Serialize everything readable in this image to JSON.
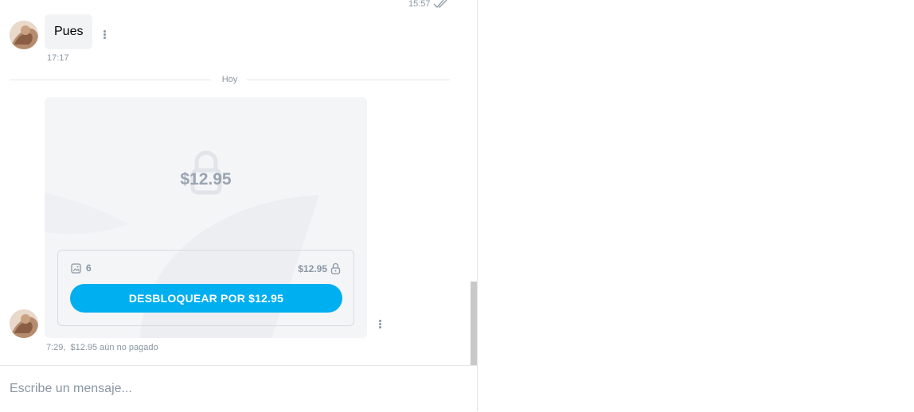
{
  "messages": {
    "top_time": "15:57",
    "pues": {
      "text": "Pues",
      "time": "17:17"
    },
    "divider": "Hoy",
    "locked_post": {
      "price_overlay": "$12.95",
      "media_count": "6",
      "price": "$12.95",
      "unlock_button": "DESBLOQUEAR POR $12.95",
      "time": "7:29,",
      "status": "$12.95 aún no pagado"
    }
  },
  "composer": {
    "placeholder": "Escribe un mensaje..."
  },
  "colors": {
    "accent": "#00aff0",
    "muted": "#8a96a3",
    "card_bg": "#f4f5f7"
  },
  "icons": [
    "double-check-icon",
    "lock-icon",
    "image-icon",
    "more-vertical-icon"
  ]
}
